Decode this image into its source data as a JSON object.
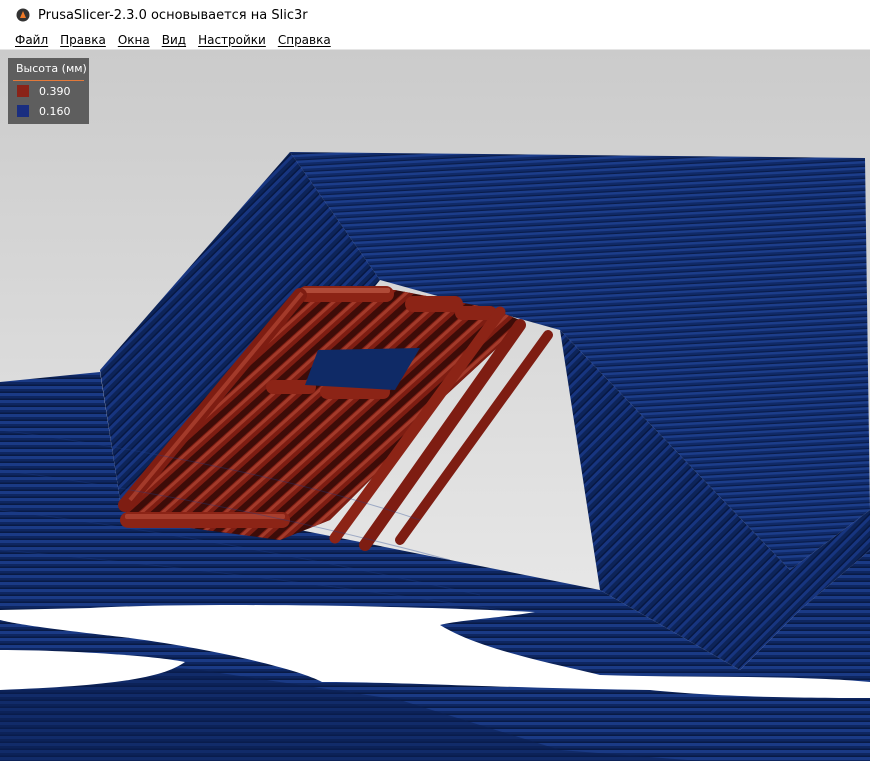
{
  "window": {
    "title": "PrusaSlicer-2.3.0 основывается на Slic3r",
    "icon": "prusaslicer-logo-icon"
  },
  "menu": [
    "Файл",
    "Правка",
    "Окна",
    "Вид",
    "Настройки",
    "Справка"
  ],
  "legend": {
    "title": "Высота (мм)",
    "items": [
      {
        "label": "0.390",
        "color": "#8a2318"
      },
      {
        "label": "0.160",
        "color": "#1a2e80"
      }
    ]
  },
  "colors": {
    "background_top": "#cfcfcf",
    "background_bottom": "#ededed",
    "layer_blue": "#0f2a66",
    "layer_red": "#7a1a10"
  }
}
